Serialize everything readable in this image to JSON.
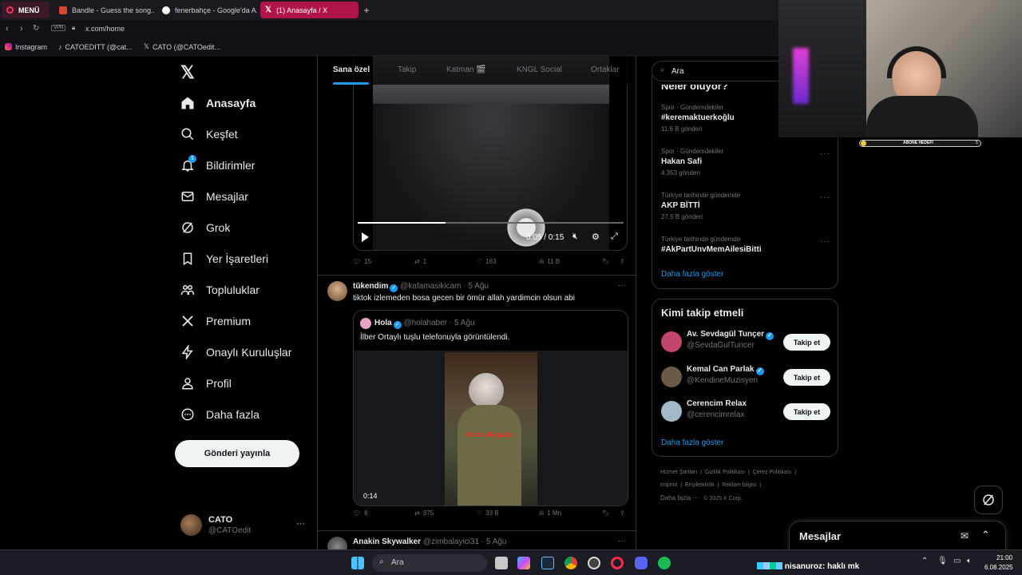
{
  "browser": {
    "menu_label": "MENÜ",
    "tabs": [
      {
        "title": "Bandle - Guess the song..."
      },
      {
        "title": "fenerbahçe - Google'da A..."
      },
      {
        "title": "(1) Anasayfa / X"
      }
    ],
    "new_tab": "+",
    "vpn": "VPN",
    "url": "x.com/home",
    "bookmarks": [
      "Instagram",
      "CATOEDITT (@cat...",
      "CATO (@CATOedit..."
    ]
  },
  "nav": {
    "items": [
      {
        "label": "Anasayfa",
        "icon": "home-icon"
      },
      {
        "label": "Keşfet",
        "icon": "search-icon"
      },
      {
        "label": "Bildirimler",
        "icon": "bell-icon",
        "badge": "1"
      },
      {
        "label": "Mesajlar",
        "icon": "mail-icon"
      },
      {
        "label": "Grok",
        "icon": "grok-icon"
      },
      {
        "label": "Yer İşaretleri",
        "icon": "bookmark-icon"
      },
      {
        "label": "Topluluklar",
        "icon": "communities-icon"
      },
      {
        "label": "Premium",
        "icon": "x-icon"
      },
      {
        "label": "Onaylı Kuruluşlar",
        "icon": "lightning-icon"
      },
      {
        "label": "Profil",
        "icon": "person-icon"
      },
      {
        "label": "Daha fazla",
        "icon": "more-circle-icon"
      }
    ],
    "post_button": "Gönderi yayınla",
    "account": {
      "name": "CATO",
      "handle": "@CATOedit",
      "more": "···"
    }
  },
  "feed": {
    "tabs": [
      "Sana özel",
      "Takip",
      "Katman 🎬",
      "KNGL Social",
      "Ortaklar"
    ],
    "video1": {
      "time": "0:05 / 0:15",
      "progress": 0.33
    },
    "post1_stats": {
      "replies": "15",
      "reposts": "1",
      "likes": "163",
      "views": "11 B"
    },
    "post2": {
      "name": "tükendim",
      "handle": "@kafamasikicam",
      "time": "· 5 Ağu",
      "text": "tiktok izlemeden bosa gecen bir ömür allah yardimcin olsun abi",
      "quote": {
        "name": "Hola",
        "handle": "@holahaber",
        "time": "· 5 Ağu",
        "text": "İlber Ortaylı tuşlu telefonuyla görüntülendi.",
        "video_duration": "0:14",
        "watermark": "Snob Magazin"
      },
      "stats": {
        "replies": "8",
        "reposts": "375",
        "likes": "33 B",
        "views": "1 Mn"
      }
    },
    "post3": {
      "name": "Anakin Skywalker",
      "handle": "@zimbalayici31",
      "time": "· 5 Ağu"
    }
  },
  "right": {
    "search_placeholder": "Ara",
    "trends_title": "Neler oluyor?",
    "trends": [
      {
        "meta": "Spor · Gündemdekiler",
        "name": "#keremaktuerkoğlu",
        "count": "11,6 B gönderi"
      },
      {
        "meta": "Spor · Gündemdekiler",
        "name": "Hakan Safi",
        "count": "4.353 gönderi"
      },
      {
        "meta": "Türkiye tarihinde gündemde",
        "name": "AKP BİTTİ",
        "count": "27,5 B gönderi"
      },
      {
        "meta": "Türkiye tarihinde gündemde",
        "name": "#AkPartUnvMemAilesiBitti",
        "count": ""
      }
    ],
    "show_more": "Daha fazla göster",
    "who_to_follow_title": "Kimi takip etmeli",
    "follow": [
      {
        "name": "Av. Sevdagül Tunçer",
        "handle": "@SevdaGulTuncer",
        "button": "Takip et",
        "color": "#c2456a"
      },
      {
        "name": "Kemal Can Parlak",
        "handle": "@KendineMuzisyen",
        "button": "Takip et",
        "color": "#6b5a48"
      },
      {
        "name": "Cerencim Relax",
        "handle": "@cerencimrelax",
        "button": "Takip et",
        "color": "#a0b8c8"
      }
    ],
    "show_more2": "Daha fazla göster",
    "footer": [
      "Hizmet Şartları",
      "Gizlilik Politikası",
      "Çerez Politikası",
      "Imprint",
      "Erişilebilirlik",
      "Reklam bilgisi",
      "Daha fazla ···",
      "© 2025 X Corp."
    ]
  },
  "messages_bar": {
    "title": "Mesajlar"
  },
  "overlay": {
    "sub_goal": "ABONE HEDEFİ",
    "sub_goal_value": "5",
    "chat_user": "nisanuroz",
    "chat_text": ": haklı mk"
  },
  "taskbar": {
    "search_placeholder": "Ara",
    "time": "21:00",
    "date": "6.08.2025"
  }
}
